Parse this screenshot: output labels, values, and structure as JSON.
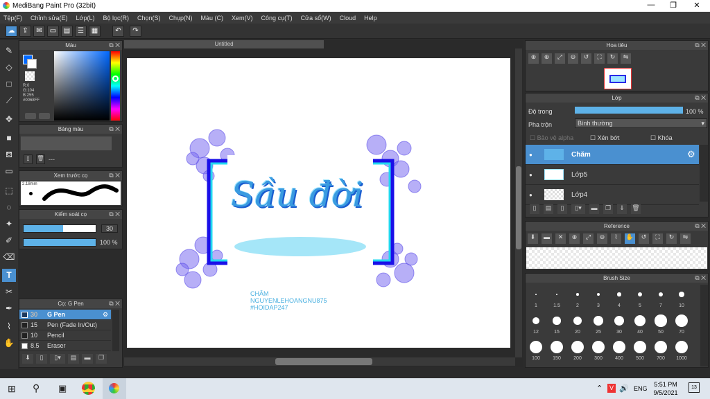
{
  "window": {
    "title": "MediBang Paint Pro (32bit)",
    "min": "—",
    "max": "❐",
    "close": "✕"
  },
  "menu": [
    "Tệp(F)",
    "Chỉnh sửa(E)",
    "Lớp(L)",
    "Bộ lọc(R)",
    "Chọn(S)",
    "Chụp(N)",
    "Màu (C)",
    "Xem(V)",
    "Công cụ(T)",
    "Cửa sổ(W)",
    "Cloud",
    "Help"
  ],
  "color_panel": {
    "title": "Màu",
    "r": "R:0",
    "g": "G:104",
    "b": "B:255",
    "hex": "#0068FF"
  },
  "palette_panel": {
    "title": "Bảng màu",
    "placeholder": "---"
  },
  "preview_panel": {
    "title": "Xem trước cọ",
    "size": "2.18mm"
  },
  "brush_control": {
    "title": "Kiểm soát cọ",
    "size": "30",
    "opacity": "100 %",
    "size_fill": 0.55,
    "opacity_fill": 1.0
  },
  "brush_list": {
    "title": "Cọ: G Pen",
    "items": [
      {
        "size": "30",
        "name": "G Pen"
      },
      {
        "size": "15",
        "name": "Pen (Fade In/Out)"
      },
      {
        "size": "10",
        "name": "Pencil"
      },
      {
        "size": "8.5",
        "name": "Eraser"
      }
    ]
  },
  "document": {
    "tab": "Untitled",
    "text1": "CHĂM",
    "text2": "NGUYENLEHOANGNU875",
    "text3": "#HOIDAP247",
    "headline": "Sầu đời"
  },
  "navigator": {
    "title": "Hoa tiêu"
  },
  "layer_panel": {
    "title": "Lớp",
    "opacity_label": "Độ trong",
    "opacity_value": "100 %",
    "blend_label": "Pha trộn",
    "blend_value": "Bình thường",
    "protect_alpha": "Bảo vệ alpha",
    "clip": "Xén bớt",
    "lock": "Khóa",
    "layers": [
      {
        "name": "Chăm"
      },
      {
        "name": "Lớp5"
      },
      {
        "name": "Lớp4"
      }
    ]
  },
  "reference": {
    "title": "Reference"
  },
  "brush_size": {
    "title": "Brush Size",
    "sizes": [
      "1",
      "1.5",
      "2",
      "3",
      "4",
      "5",
      "7",
      "10",
      "12",
      "15",
      "20",
      "25",
      "30",
      "40",
      "50",
      "70",
      "100",
      "150",
      "200",
      "300",
      "400",
      "500",
      "700",
      "1000"
    ]
  },
  "taskbar": {
    "lang": "ENG",
    "time": "5:51 PM",
    "date": "9/5/2021",
    "notif": "13"
  }
}
